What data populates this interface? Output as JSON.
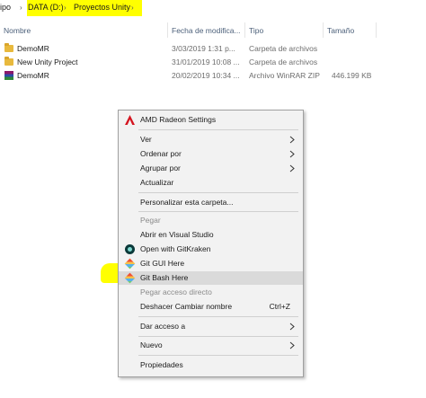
{
  "breadcrumb": {
    "prefix": "ipo",
    "drive": "DATA (D:)",
    "folder": "Proyectos Unity",
    "sep": "›"
  },
  "columns": {
    "name": "Nombre",
    "date": "Fecha de modifica...",
    "type": "Tipo",
    "size": "Tamaño"
  },
  "files": [
    {
      "name": "DemoMR",
      "date": "3/03/2019 1:31 p...",
      "type": "Carpeta de archivos",
      "size": "",
      "icon": "folder-icon"
    },
    {
      "name": "New Unity Project",
      "date": "31/01/2019 10:08 ...",
      "type": "Carpeta de archivos",
      "size": "",
      "icon": "folder-icon"
    },
    {
      "name": "DemoMR",
      "date": "20/02/2019 10:34 ...",
      "type": "Archivo WinRAR ZIP",
      "size": "446.199 KB",
      "icon": "winrar-icon"
    }
  ],
  "menu": {
    "amd": "AMD Radeon Settings",
    "ver": "Ver",
    "ordenar": "Ordenar por",
    "agrupar": "Agrupar por",
    "actualizar": "Actualizar",
    "personalizar": "Personalizar esta carpeta...",
    "pegar": "Pegar",
    "vs": "Abrir en Visual Studio",
    "gitkraken": "Open with GitKraken",
    "gitgui": "Git GUI Here",
    "gitbash": "Git Bash Here",
    "pegar_acceso": "Pegar acceso directo",
    "deshacer": "Deshacer Cambiar nombre",
    "deshacer_shortcut": "Ctrl+Z",
    "dar_acceso": "Dar acceso a",
    "nuevo": "Nuevo",
    "propiedades": "Propiedades"
  },
  "colors": {
    "highlight": "#ffff00",
    "menu_bg": "#f2f2f2",
    "folder": "#e8b93d"
  }
}
